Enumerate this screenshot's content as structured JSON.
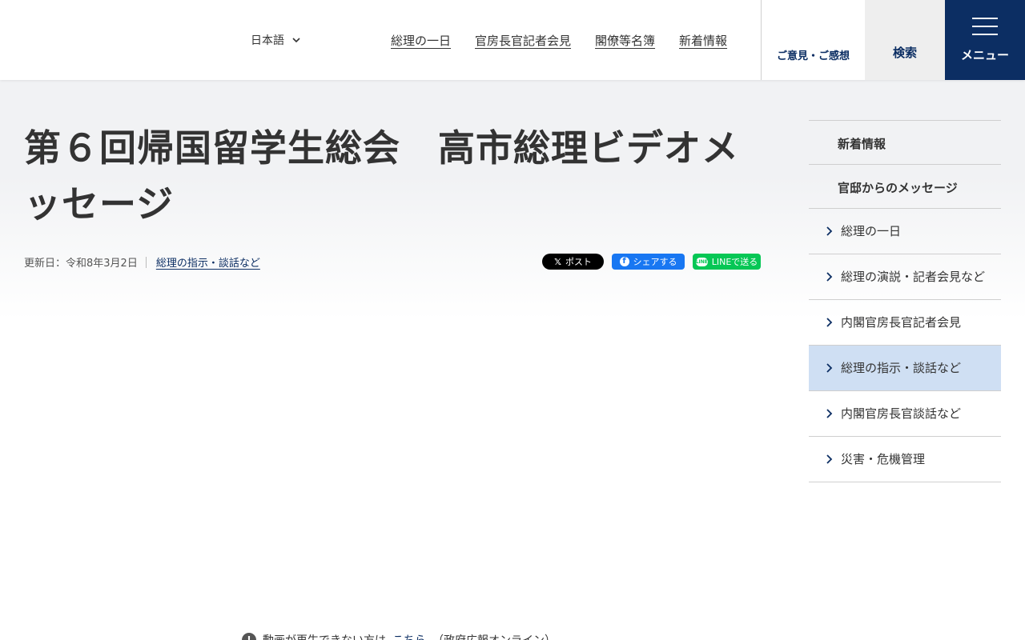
{
  "header": {
    "language": "日本語",
    "nav": [
      "総理の一日",
      "官房長官記者会見",
      "閣僚等名簿",
      "新着情報"
    ],
    "feedback": "ご意見・ご感想",
    "search": "検索",
    "menu": "メニュー"
  },
  "article": {
    "title": "第６回帰国留学生総会　高市総理ビデオメッセージ",
    "updated": "更新日：令和8年3月2日",
    "category": "総理の指示・談話など"
  },
  "share": {
    "x": "ポスト",
    "facebook": "シェアする",
    "line": "LINEで送る",
    "x_icon": "𝕏",
    "facebook_icon": "f",
    "line_icon": "LINE"
  },
  "sidebar": {
    "heads": [
      "新着情報",
      "官邸からのメッセージ"
    ],
    "items": [
      "総理の一日",
      "総理の演説・記者会見など",
      "内閣官房長官記者会見",
      "総理の指示・談話など",
      "内閣官房長官談話など",
      "災害・危機管理"
    ],
    "active_index": 3
  },
  "note": {
    "icon": "!",
    "text": "動画が再生できない方は",
    "link": "こちら",
    "suffix": "（政府広報オンライン）"
  },
  "colors": {
    "navy": "#0c2e63",
    "active_bg": "#cfdff3",
    "x": "#000000",
    "facebook": "#1877f2",
    "line": "#06c755"
  }
}
